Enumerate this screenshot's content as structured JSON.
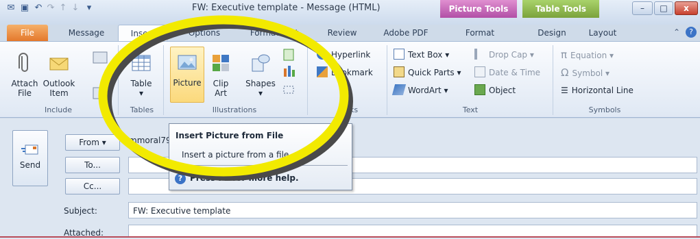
{
  "window": {
    "title": "FW: Executive template - Message (HTML)",
    "context_tabs": [
      "Picture Tools",
      "Table Tools"
    ],
    "controls": {
      "minimize": "–",
      "maximize": "□",
      "close": "x"
    }
  },
  "tabs": [
    "File",
    "Message",
    "Insert",
    "Options",
    "Format Text",
    "Review",
    "Adobe PDF",
    "Format",
    "Design",
    "Layout"
  ],
  "ribbon": {
    "include": {
      "label": "Include",
      "attach_file": [
        "Attach",
        "File"
      ],
      "outlook_item": [
        "Outlook",
        "Item"
      ]
    },
    "tables": {
      "label": "Tables",
      "table": "Table"
    },
    "illustrations": {
      "label": "Illustrations",
      "picture": "Picture",
      "clip_art": [
        "Clip",
        "Art"
      ],
      "shapes": "Shapes"
    },
    "links": {
      "label": "Links",
      "hyperlink": "Hyperlink",
      "bookmark": "Bookmark"
    },
    "text": {
      "label": "Text",
      "text_box": "Text Box",
      "quick_parts": "Quick Parts",
      "wordart": "WordArt",
      "drop_cap": "Drop Cap",
      "date_time": "Date & Time",
      "object": "Object"
    },
    "symbols": {
      "label": "Symbols",
      "equation": "Equation",
      "symbol": "Symbol",
      "horizontal_line": "Horizontal Line"
    }
  },
  "message": {
    "send": "Send",
    "from_label": "From",
    "from_value": "mmoral79",
    "to_label": "To...",
    "cc_label": "Cc...",
    "subject_label": "Subject:",
    "subject_value": "FW: Executive template",
    "attached_label": "Attached:"
  },
  "tooltip": {
    "title": "Insert Picture from File",
    "description": "Insert a picture from a file.",
    "help": "Press F1 for more help."
  },
  "colors": {
    "highlight_ellipse": "#f2ea00",
    "ellipse_shadow": "#4a4a4a",
    "file_tab": "#e4782c",
    "picture_tools": "#b14fa6",
    "table_tools": "#7ba23b"
  }
}
